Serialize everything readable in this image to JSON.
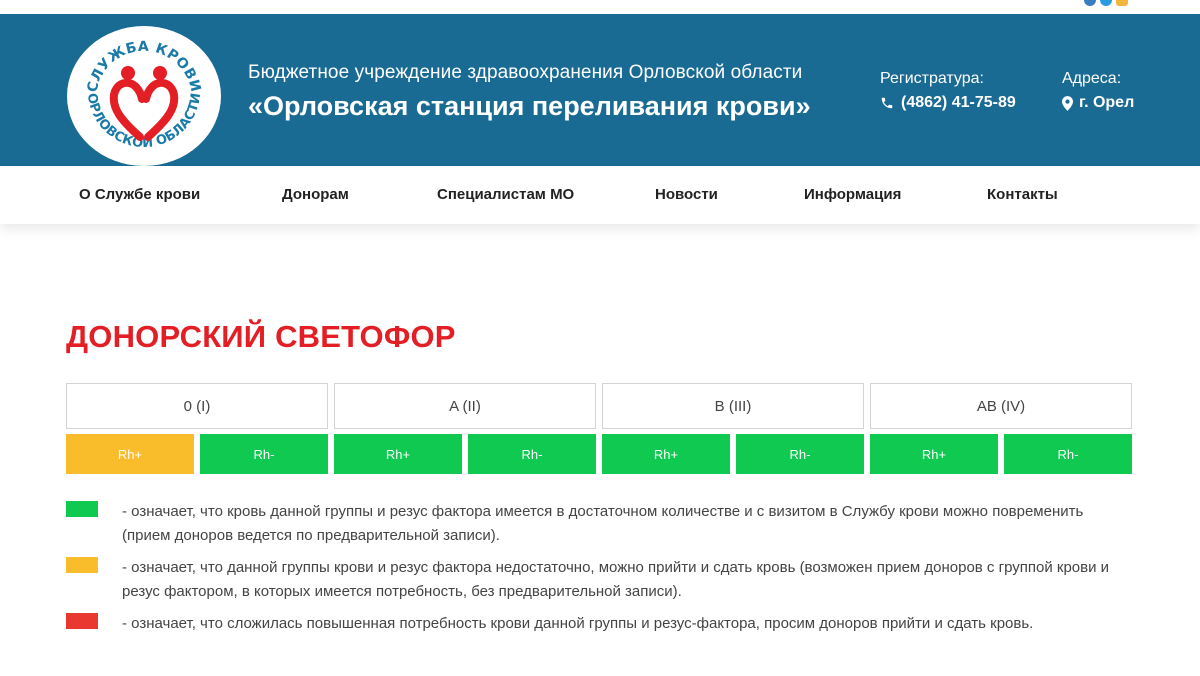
{
  "colors": {
    "header_bg": "#1a6b94",
    "accent_red": "#e31e24",
    "status_green": "#10c951",
    "status_yellow": "#f9bc2b",
    "status_red": "#e8382f"
  },
  "logo": {
    "top_text": "СЛУЖБА КРОВИ",
    "bottom_text": "ОРЛОВСКОЙ ОБЛАСТИ"
  },
  "header": {
    "org_subtitle": "Бюджетное учреждение здравоохранения Орловской области",
    "org_title": "«Орловская станция переливания крови»",
    "registry_label": "Регистратура:",
    "registry_phone": "(4862) 41-75-89",
    "address_label": "Адреса:",
    "address_value": "г. Орел"
  },
  "nav": [
    {
      "label": "О Службе крови"
    },
    {
      "label": "Донорам"
    },
    {
      "label": "Специалистам МО"
    },
    {
      "label": "Новости"
    },
    {
      "label": "Информация"
    },
    {
      "label": "Контакты"
    }
  ],
  "page_title": "ДОНОРСКИЙ СВЕТОФОР",
  "blood_groups": [
    {
      "name": "0 (I)",
      "rh": [
        {
          "label": "Rh+",
          "status": "yellow"
        },
        {
          "label": "Rh-",
          "status": "green"
        }
      ]
    },
    {
      "name": "A (II)",
      "rh": [
        {
          "label": "Rh+",
          "status": "green"
        },
        {
          "label": "Rh-",
          "status": "green"
        }
      ]
    },
    {
      "name": "B (III)",
      "rh": [
        {
          "label": "Rh+",
          "status": "green"
        },
        {
          "label": "Rh-",
          "status": "green"
        }
      ]
    },
    {
      "name": "AB (IV)",
      "rh": [
        {
          "label": "Rh+",
          "status": "green"
        },
        {
          "label": "Rh-",
          "status": "green"
        }
      ]
    }
  ],
  "legend": [
    {
      "status": "green",
      "text": "- означает, что кровь данной группы и резус фактора имеется в достаточном количестве и с визитом в Службу крови можно повременить (прием доноров ведется по предварительной записи)."
    },
    {
      "status": "yellow",
      "text": "- означает, что данной группы крови и резус фактора недостаточно, можно прийти и сдать кровь (возможен прием доноров с группой крови и резус фактором, в которых имеется потребность, без предварительной записи)."
    },
    {
      "status": "red",
      "text": "- означает, что сложилась повышенная потребность крови данной группы и резус-фактора, просим доноров прийти и сдать кровь."
    }
  ]
}
